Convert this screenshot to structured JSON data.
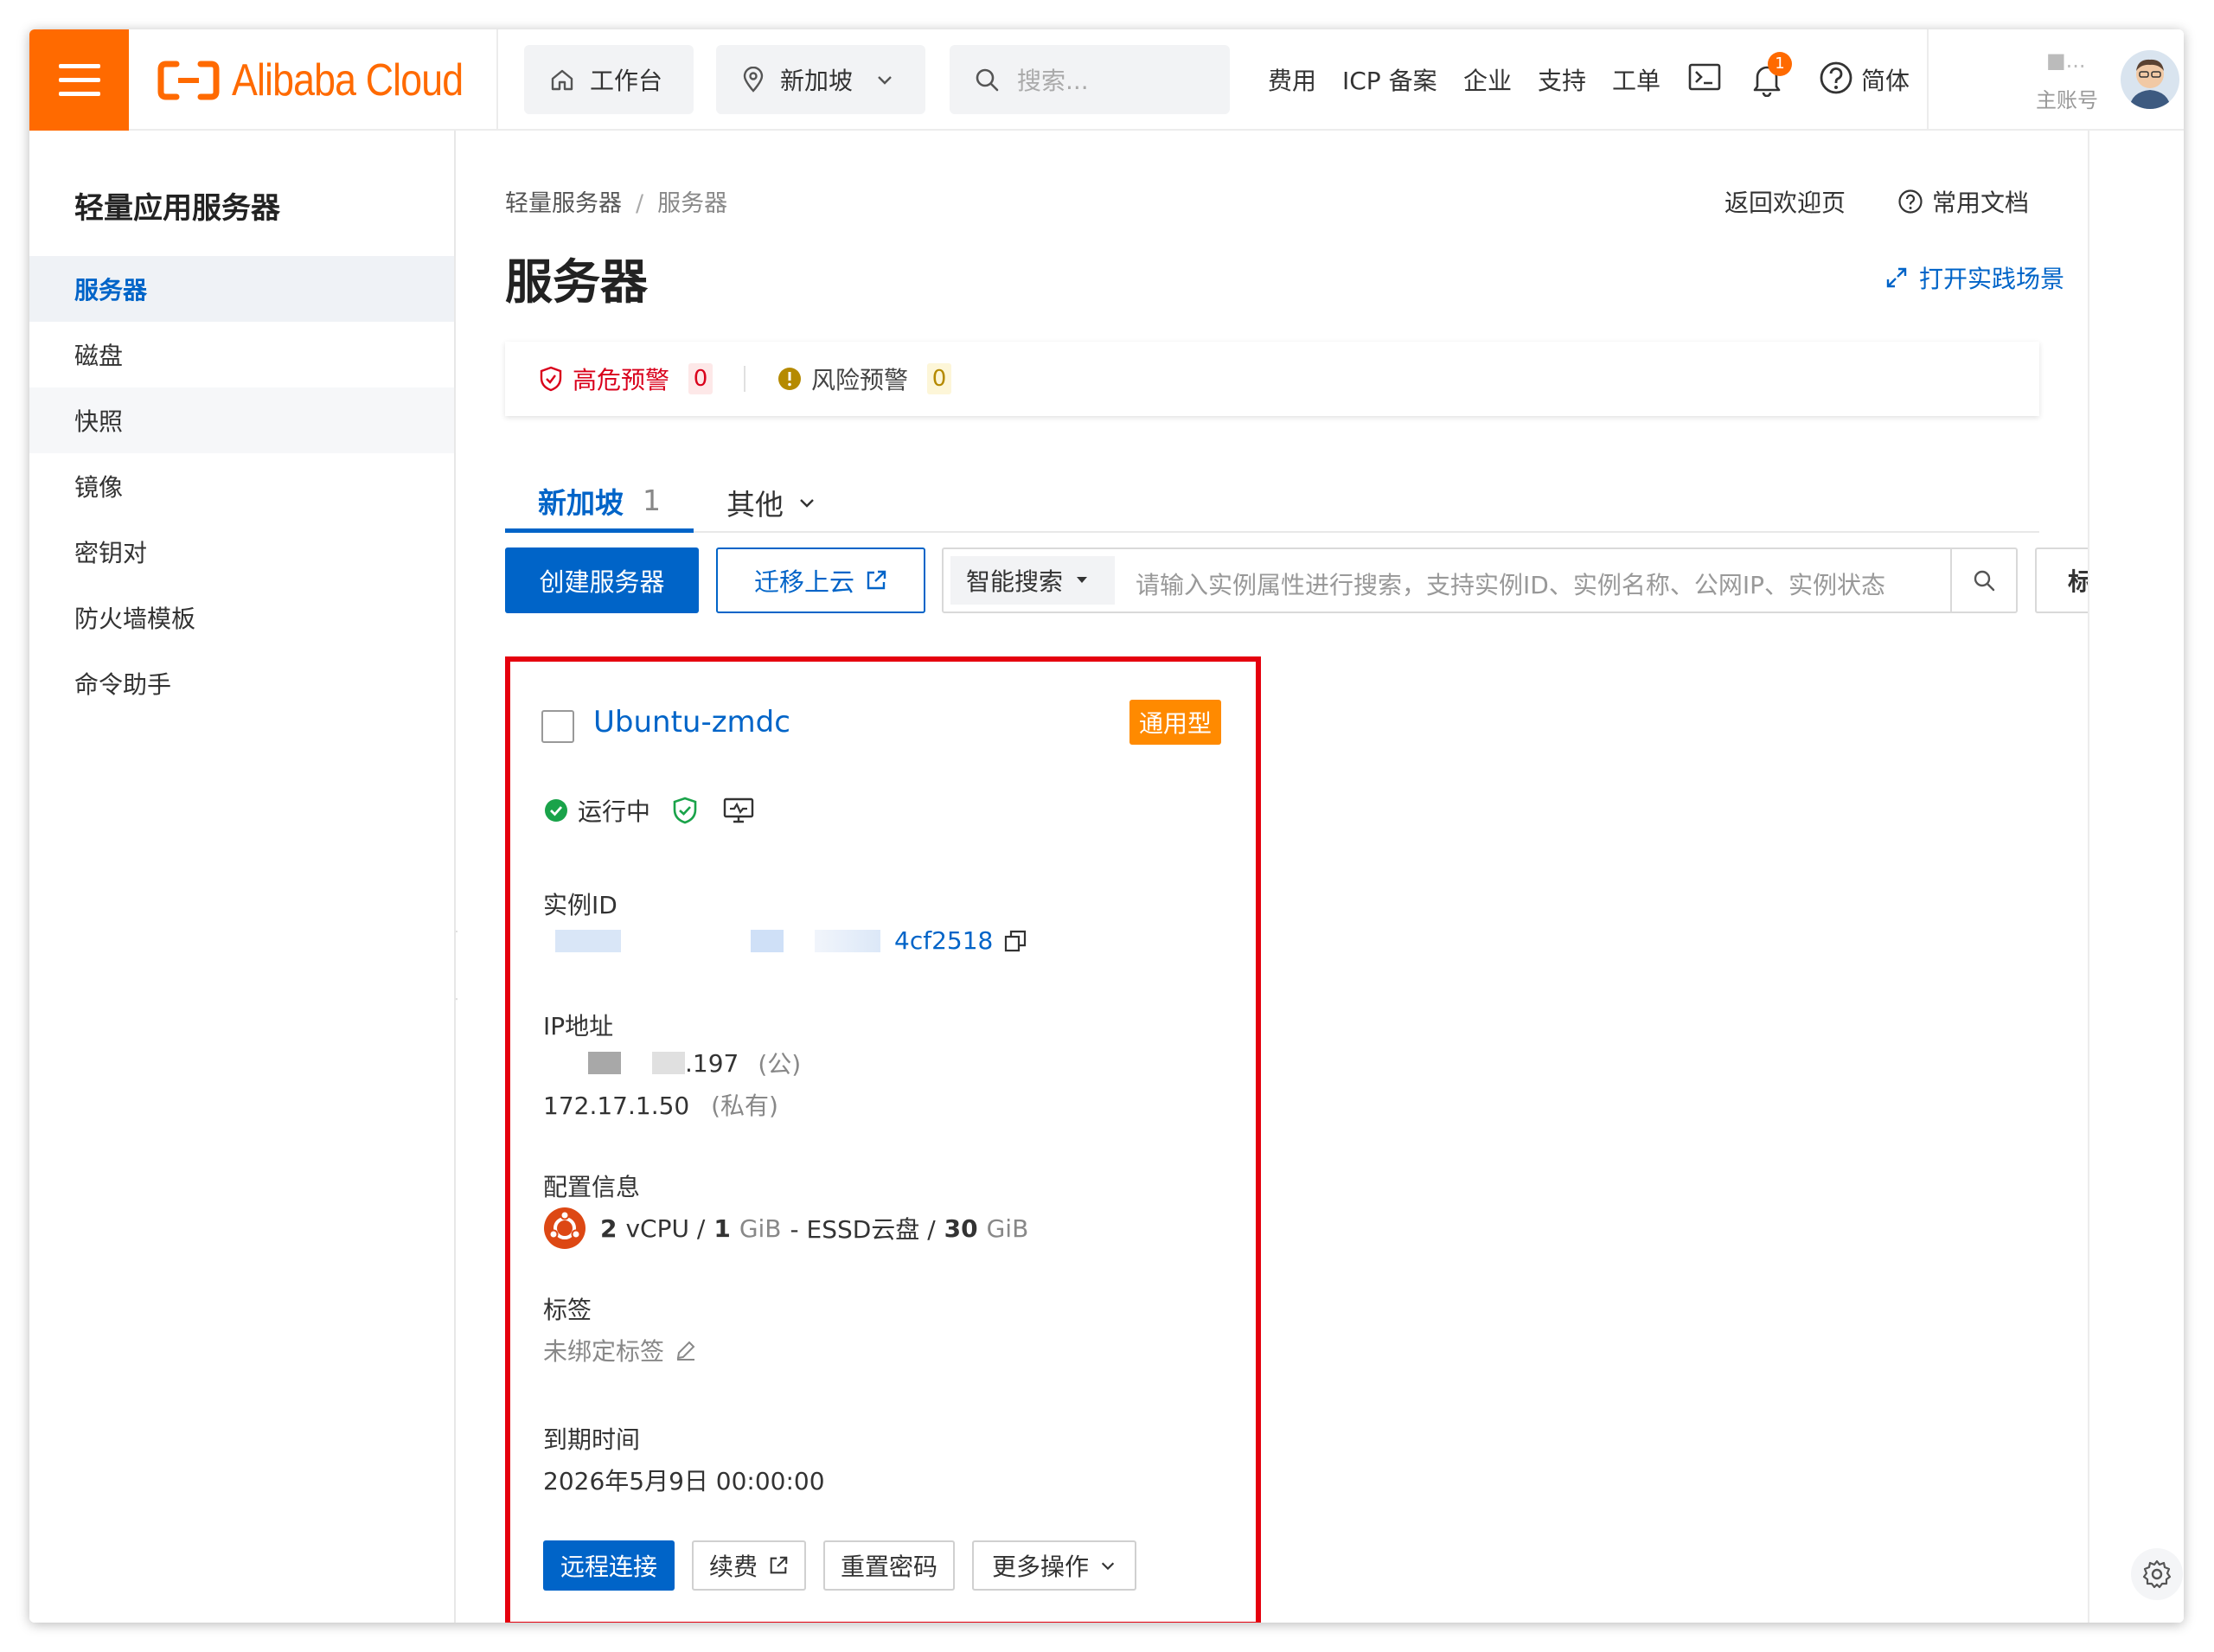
{
  "topbar": {
    "brand": "Alibaba Cloud",
    "workbench": "工作台",
    "region": "新加坡",
    "search_placeholder": "搜索...",
    "links": [
      "费用",
      "ICP 备案",
      "企业",
      "支持",
      "工单"
    ],
    "notification_count": "1",
    "language": "简体",
    "account_name": "■...",
    "account_type": "主账号"
  },
  "sidebar": {
    "title": "轻量应用服务器",
    "items": [
      {
        "label": "服务器",
        "active": true
      },
      {
        "label": "磁盘"
      },
      {
        "label": "快照"
      },
      {
        "label": "镜像"
      },
      {
        "label": "密钥对"
      },
      {
        "label": "防火墙模板"
      },
      {
        "label": "命令助手"
      }
    ]
  },
  "main": {
    "breadcrumb": [
      "轻量服务器",
      "服务器"
    ],
    "title": "服务器",
    "back_link": "返回欢迎页",
    "docs_link": "常用文档",
    "scene_link": "打开实践场景",
    "alerts": {
      "high_label": "高危预警",
      "high_count": "0",
      "risk_label": "风险预警",
      "risk_count": "0"
    },
    "tabs": [
      {
        "label": "新加坡",
        "count": "1"
      },
      {
        "label": "其他"
      }
    ],
    "toolbar": {
      "create": "创建服务器",
      "migrate": "迁移上云",
      "search_select": "智能搜索",
      "search_placeholder": "请输入实例属性进行搜索，支持实例ID、实例名称、公网IP、实例状态",
      "tag_button": "标"
    }
  },
  "instance": {
    "name": "Ubuntu-zmdc",
    "type": "通用型",
    "status": "运行中",
    "id_label": "实例ID",
    "id_suffix": "4cf2518",
    "ip_label": "IP地址",
    "public_ip_suffix": ".197",
    "public_tag": "(公)",
    "private_ip": "172.17.1.50",
    "private_tag": "(私有)",
    "config_label": "配置信息",
    "config": {
      "cpu": "2",
      "cpu_unit": "vCPU /",
      "mem": "1",
      "mem_unit": "GiB",
      "disk_type": "- ESSD云盘 /",
      "disk": "30",
      "disk_unit": "GiB"
    },
    "tags_label": "标签",
    "tags_value": "未绑定标签",
    "expire_label": "到期时间",
    "expire_value": "2026年5月9日 00:00:00",
    "actions": [
      "远程连接",
      "续费",
      "重置密码",
      "更多操作"
    ]
  },
  "colors": {
    "brand_orange": "#ff6a00",
    "primary_blue": "#0064c8",
    "highlight_red": "#e5000e",
    "type_badge": "#ff8a00",
    "running_green": "#1aa34a"
  }
}
